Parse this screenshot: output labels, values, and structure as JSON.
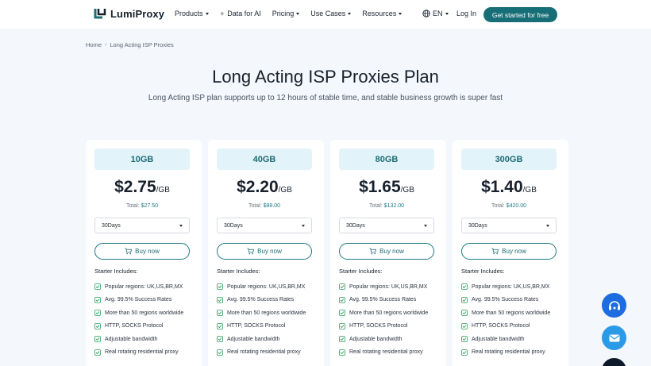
{
  "nav": {
    "logo_text": "LumiProxy",
    "menu": [
      "Products",
      "Data for AI",
      "Pricing",
      "Use Cases",
      "Resources"
    ],
    "lang": "EN",
    "login": "Log In",
    "cta": "Get started for free"
  },
  "breadcrumb": {
    "home": "Home",
    "current": "Long Acting ISP Proxies"
  },
  "hero": {
    "title": "Long Acting ISP Proxies Plan",
    "subtitle": "Long Acting ISP plan supports up to 12 hours of stable time, and stable business growth is super fast"
  },
  "plans": [
    {
      "name": "10GB",
      "price": "$2.75",
      "unit": "/GB",
      "total_label": "Total:",
      "total": "$27.50",
      "duration": "30Days",
      "buy": "Buy now"
    },
    {
      "name": "40GB",
      "price": "$2.20",
      "unit": "/GB",
      "total_label": "Total:",
      "total": "$88.00",
      "duration": "30Days",
      "buy": "Buy now"
    },
    {
      "name": "80GB",
      "price": "$1.65",
      "unit": "/GB",
      "total_label": "Total:",
      "total": "$132.00",
      "duration": "30Days",
      "buy": "Buy now"
    },
    {
      "name": "300GB",
      "price": "$1.40",
      "unit": "/GB",
      "total_label": "Total:",
      "total": "$420.00",
      "duration": "30Days",
      "buy": "Buy now"
    }
  ],
  "includes_title": "Starter Includes:",
  "features": [
    "Popular regions: UK,US,BR,MX",
    "Avg. 99.5% Success Rates",
    "More than 50 regions worldwide",
    "HTTP, SOCKS Protocol",
    "Adjustable bandwidth",
    "Real rotating residential proxy"
  ],
  "colors": {
    "brand": "#176e77",
    "accent_light": "#e3f3fa",
    "check": "#2a9d5c"
  },
  "icons": [
    "logo-icon",
    "sparkle-icon",
    "globe-icon",
    "chevron-down-icon",
    "cart-icon",
    "check-icon",
    "support-icon",
    "mail-icon"
  ]
}
